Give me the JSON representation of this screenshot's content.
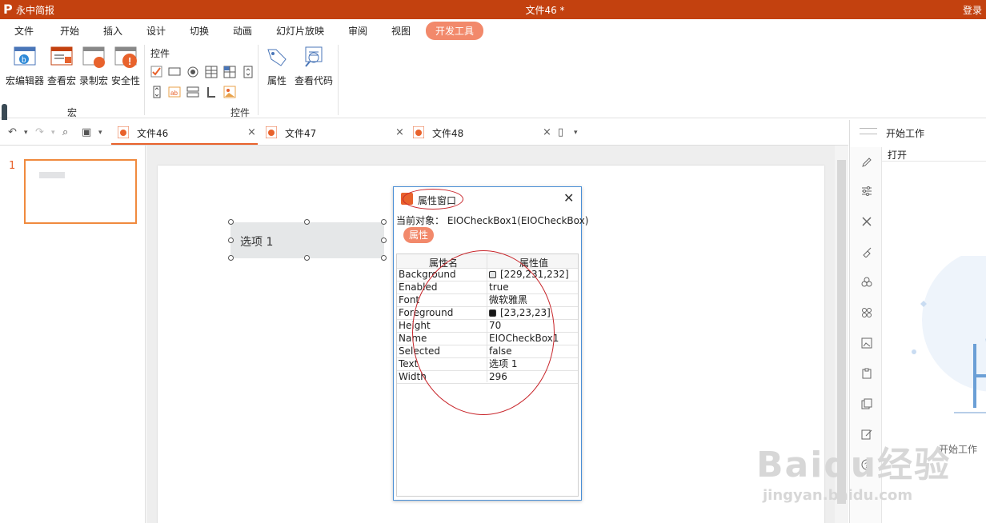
{
  "app": {
    "name": "永中简报",
    "document_title": "文件46 *",
    "login": "登录"
  },
  "menu": [
    "文件",
    "开始",
    "插入",
    "设计",
    "切换",
    "动画",
    "幻灯片放映",
    "审阅",
    "视图",
    "开发工具"
  ],
  "ribbon": {
    "macro_buttons": [
      "宏编辑器",
      "查看宏",
      "录制宏",
      "安全性"
    ],
    "macro_group": "宏",
    "controls_title": "控件",
    "controls_group": "控件",
    "property_button": "属性",
    "view_code_button": "查看代码"
  },
  "doc_tabs": [
    "文件46",
    "文件47",
    "文件48"
  ],
  "thumbnails": {
    "slide_number": "1"
  },
  "slide": {
    "checkbox_text": "选项 1"
  },
  "property_window": {
    "title": "属性窗口",
    "current_object": "当前对象： EIOCheckBox1(EIOCheckBox)",
    "tab": "属性",
    "col_name": "属性名",
    "col_value": "属性值",
    "rows": [
      {
        "name": "Background",
        "value": "[229,231,232]"
      },
      {
        "name": "Enabled",
        "value": "true"
      },
      {
        "name": "Font",
        "value": "微软雅黑"
      },
      {
        "name": "Foreground",
        "value": "[23,23,23]"
      },
      {
        "name": "Height",
        "value": "70"
      },
      {
        "name": "Name",
        "value": "EIOCheckBox1"
      },
      {
        "name": "Selected",
        "value": "false"
      },
      {
        "name": "Text",
        "value": "选项 1"
      },
      {
        "name": "Width",
        "value": "296"
      }
    ],
    "background_swatch": "#e5e7e8",
    "foreground_swatch": "#171717"
  },
  "right_pane": {
    "title": "开始工作",
    "open": "打开",
    "caption": "开始工作"
  },
  "watermark": {
    "line1": "Baidu经验",
    "line2": "jingyan.baidu.com"
  },
  "colors": {
    "brand": "#c3410f",
    "accent": "#f2896b",
    "annotation": "#c8262b"
  }
}
